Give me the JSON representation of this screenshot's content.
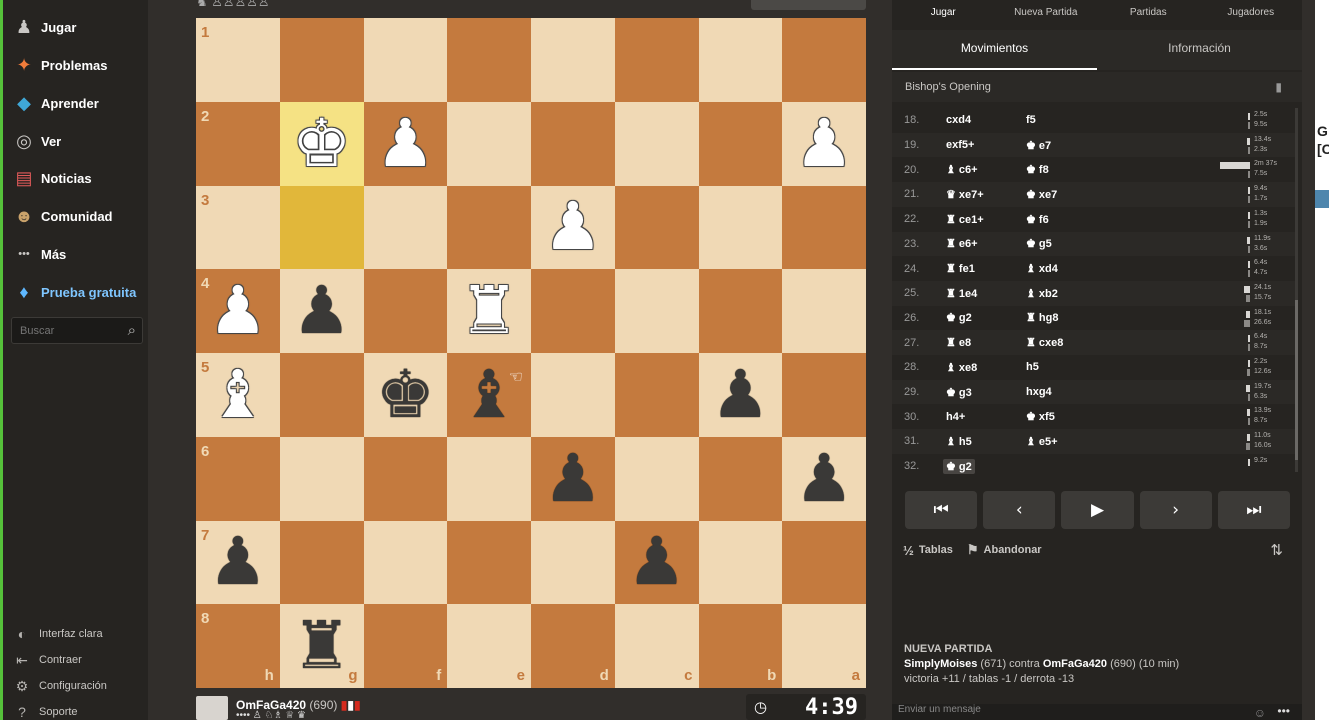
{
  "nav": {
    "items": [
      {
        "label": "Jugar",
        "icon": "pawn-hand-icon",
        "glyph": "♟"
      },
      {
        "label": "Problemas",
        "icon": "puzzle-icon",
        "glyph": "✦"
      },
      {
        "label": "Aprender",
        "icon": "graduation-cap-icon",
        "glyph": "◆"
      },
      {
        "label": "Ver",
        "icon": "binoculars-icon",
        "glyph": "◎"
      },
      {
        "label": "Noticias",
        "icon": "newspaper-icon",
        "glyph": "▤"
      },
      {
        "label": "Comunidad",
        "icon": "people-icon",
        "glyph": "☻"
      },
      {
        "label": "Más",
        "icon": "more-dots-icon",
        "glyph": "•••"
      },
      {
        "label": "Prueba gratuita",
        "icon": "diamond-icon",
        "glyph": "♦"
      }
    ],
    "search_placeholder": "Buscar",
    "footer": [
      {
        "label": "Interfaz clara",
        "icon": "theme-toggle-icon",
        "glyph": "◐"
      },
      {
        "label": "Contraer",
        "icon": "collapse-icon",
        "glyph": "⇤"
      },
      {
        "label": "Configuración",
        "icon": "gear-icon",
        "glyph": "⚙"
      },
      {
        "label": "Soporte",
        "icon": "help-icon",
        "glyph": "?"
      }
    ]
  },
  "board": {
    "highlight": {
      "king_square": "g2",
      "from_square": "g3"
    },
    "pieces": [
      {
        "sq": "g2",
        "color": "w",
        "glyph": "♚",
        "name": "white-king"
      },
      {
        "sq": "f2",
        "color": "w",
        "glyph": "♟",
        "name": "white-pawn"
      },
      {
        "sq": "a2",
        "color": "w",
        "glyph": "♟",
        "name": "white-pawn"
      },
      {
        "sq": "d3",
        "color": "w",
        "glyph": "♟",
        "name": "white-pawn"
      },
      {
        "sq": "h4",
        "color": "w",
        "glyph": "♟",
        "name": "white-pawn"
      },
      {
        "sq": "g4",
        "color": "b",
        "glyph": "♟",
        "name": "black-pawn"
      },
      {
        "sq": "e4",
        "color": "w",
        "glyph": "♜",
        "name": "white-rook"
      },
      {
        "sq": "h5",
        "color": "w",
        "glyph": "♝",
        "name": "white-bishop"
      },
      {
        "sq": "f5",
        "color": "b",
        "glyph": "♚",
        "name": "black-king"
      },
      {
        "sq": "e5",
        "color": "b",
        "glyph": "♝",
        "name": "black-bishop"
      },
      {
        "sq": "b5",
        "color": "b",
        "glyph": "♟",
        "name": "black-pawn"
      },
      {
        "sq": "d6",
        "color": "b",
        "glyph": "♟",
        "name": "black-pawn"
      },
      {
        "sq": "a6",
        "color": "b",
        "glyph": "♟",
        "name": "black-pawn"
      },
      {
        "sq": "h7",
        "color": "b",
        "glyph": "♟",
        "name": "black-pawn"
      },
      {
        "sq": "c7",
        "color": "b",
        "glyph": "♟",
        "name": "black-pawn"
      },
      {
        "sq": "g8",
        "color": "b",
        "glyph": "♜",
        "name": "black-rook"
      }
    ],
    "files_order": [
      "h",
      "g",
      "f",
      "e",
      "d",
      "c",
      "b",
      "a"
    ],
    "ranks_order": [
      "1",
      "2",
      "3",
      "4",
      "5",
      "6",
      "7",
      "8"
    ]
  },
  "player": {
    "name": "OmFaGa420",
    "rating": "(690)",
    "captured": "•••• ♙ ♘♗ ♕ ♛",
    "clock": "4:39"
  },
  "panel": {
    "top_tabs": [
      "Jugar",
      "Nueva Partida",
      "Partidas",
      "Jugadores"
    ],
    "sub_tabs": [
      "Movimientos",
      "Información"
    ],
    "opening": "Bishop's Opening",
    "moves": [
      {
        "n": "18.",
        "w": "cxd4",
        "b": "f5",
        "tw": 0.02,
        "tb": 0.07,
        "lw": "2.5s",
        "lb": "9.5s"
      },
      {
        "n": "19.",
        "w": "exf5+",
        "b": "♚ e7",
        "tw": 0.1,
        "tb": 0.02,
        "lw": "13.4s",
        "lb": "2.3s"
      },
      {
        "n": "20.",
        "w": "♝ c6+",
        "b": "♚ f8",
        "tw": 1.0,
        "tb": 0.06,
        "lw": "2m 37s",
        "lb": "7.5s"
      },
      {
        "n": "21.",
        "w": "♛ xe7+",
        "b": "♚ xe7",
        "tw": 0.07,
        "tb": 0.01,
        "lw": "9.4s",
        "lb": "1.7s"
      },
      {
        "n": "22.",
        "w": "♜ ce1+",
        "b": "♚ f6",
        "tw": 0.01,
        "tb": 0.01,
        "lw": "1.3s",
        "lb": "1.9s"
      },
      {
        "n": "23.",
        "w": "♜ e6+",
        "b": "♚ g5",
        "tw": 0.09,
        "tb": 0.03,
        "lw": "11.9s",
        "lb": "3.6s"
      },
      {
        "n": "24.",
        "w": "♜ fe1",
        "b": "♝ xd4",
        "tw": 0.05,
        "tb": 0.04,
        "lw": "6.4s",
        "lb": "4.7s"
      },
      {
        "n": "25.",
        "w": "♜ 1e4",
        "b": "♝ xb2",
        "tw": 0.19,
        "tb": 0.12,
        "lw": "24.1s",
        "lb": "15.7s"
      },
      {
        "n": "26.",
        "w": "♚ g2",
        "b": "♜ hg8",
        "tw": 0.14,
        "tb": 0.2,
        "lw": "18.1s",
        "lb": "26.6s"
      },
      {
        "n": "27.",
        "w": "♜ e8",
        "b": "♜ cxe8",
        "tw": 0.05,
        "tb": 0.07,
        "lw": "6.4s",
        "lb": "8.7s"
      },
      {
        "n": "28.",
        "w": "♝ xe8",
        "b": "h5",
        "tw": 0.02,
        "tb": 0.1,
        "lw": "2.2s",
        "lb": "12.6s"
      },
      {
        "n": "29.",
        "w": "♚ g3",
        "b": "hxg4",
        "tw": 0.15,
        "tb": 0.05,
        "lw": "19.7s",
        "lb": "6.3s"
      },
      {
        "n": "30.",
        "w": "h4+",
        "b": "♚ xf5",
        "tw": 0.11,
        "tb": 0.07,
        "lw": "13.9s",
        "lb": "8.7s"
      },
      {
        "n": "31.",
        "w": "♝ h5",
        "b": "♝ e5+",
        "tw": 0.09,
        "tb": 0.13,
        "lw": "11.0s",
        "lb": "16.0s"
      },
      {
        "n": "32.",
        "w": "♚ g2",
        "b": "",
        "tw": 0.07,
        "tb": 0,
        "lw": "9.2s",
        "lb": ""
      }
    ],
    "actions": {
      "draw": "Tablas",
      "draw_glyph": "½",
      "resign": "Abandonar",
      "resign_glyph": "⚑"
    },
    "info": {
      "title": "NUEVA PARTIDA",
      "white": "SimplyMoises",
      "white_rating": "(671)",
      "vs": "contra",
      "black": "OmFaGa420",
      "black_rating": "(690)",
      "time_control": "(10 min)",
      "stats": "victoria +11 / tablas -1 / derrota -13"
    },
    "message_placeholder": "Enviar un mensaje"
  },
  "edge": {
    "text": "G\n[C"
  }
}
